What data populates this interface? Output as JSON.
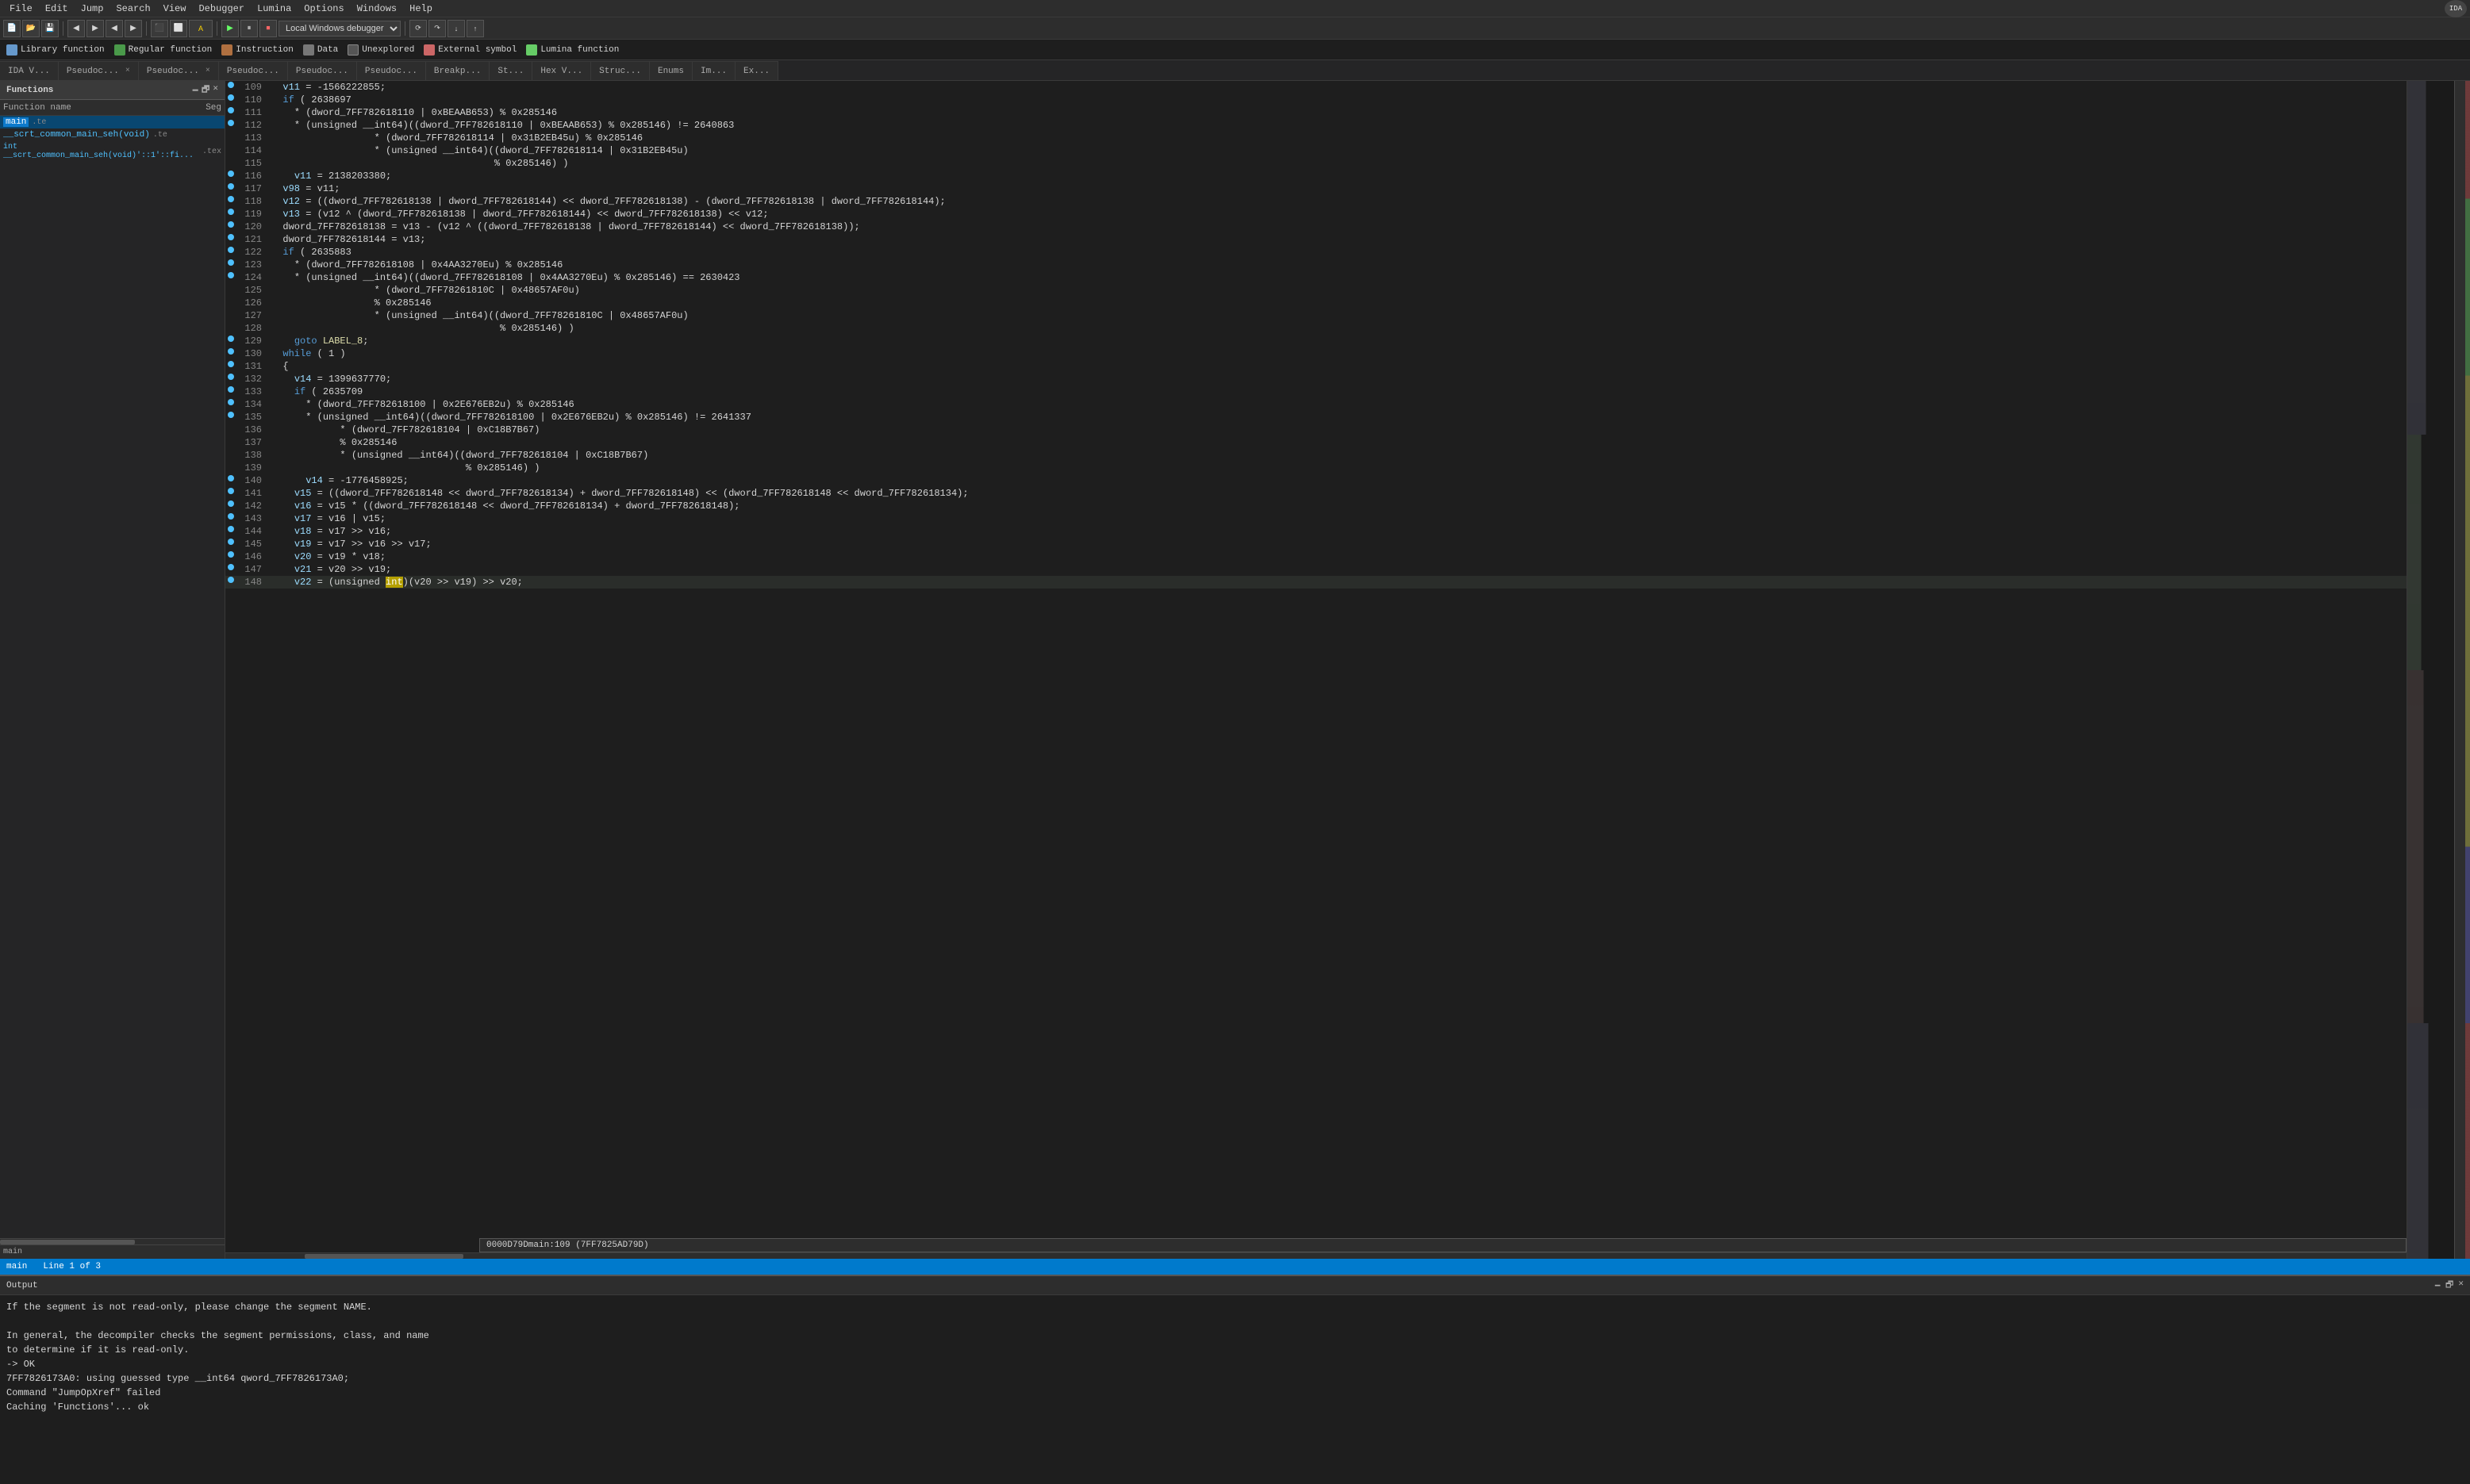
{
  "app": {
    "title": "IDA - main"
  },
  "menu": {
    "items": [
      "File",
      "Edit",
      "Jump",
      "Search",
      "View",
      "Debugger",
      "Lumina",
      "Options",
      "Windows",
      "Help"
    ]
  },
  "nav_indicators": [
    {
      "label": "Library function",
      "color": "#6699cc"
    },
    {
      "label": "Regular function",
      "color": "#4a9a4a"
    },
    {
      "label": "Instruction",
      "color": "#b07040"
    },
    {
      "label": "Data",
      "color": "#777"
    },
    {
      "label": "Unexplored",
      "color": "#444"
    },
    {
      "label": "External symbol",
      "color": "#cc6666"
    },
    {
      "label": "Lumina function",
      "color": "#66cc66"
    }
  ],
  "tabs": {
    "items": [
      {
        "label": "IDA V...",
        "active": false,
        "icon": "📄"
      },
      {
        "label": "Pseudoc...",
        "active": false,
        "icon": "📄",
        "close": true
      },
      {
        "label": "Pseudoc...",
        "active": false,
        "icon": "📄",
        "close": true
      },
      {
        "label": "Pseudoc...",
        "active": false,
        "icon": "📄"
      },
      {
        "label": "Pseudoc...",
        "active": false,
        "icon": "📄"
      },
      {
        "label": "Pseudoc...",
        "active": false,
        "icon": "📄"
      },
      {
        "label": "Breakp...",
        "active": false,
        "icon": "📄"
      },
      {
        "label": "St...",
        "active": false,
        "icon": "📄"
      },
      {
        "label": "Hex V...",
        "active": false,
        "icon": "📄"
      },
      {
        "label": "Struc...",
        "active": false,
        "icon": "📄"
      },
      {
        "label": "Enums",
        "active": false,
        "icon": "📄"
      },
      {
        "label": "Im...",
        "active": false,
        "icon": "📄"
      },
      {
        "label": "Ex...",
        "active": false,
        "icon": "📄"
      }
    ]
  },
  "left_panel": {
    "title": "Functions",
    "subheader": "Function name",
    "subheader2": "Seg",
    "functions": [
      {
        "name": "main",
        "seg": ".te",
        "selected": true
      },
      {
        "name": "__scrt_common_main_seh(void)",
        "seg": ".te"
      },
      {
        "name": "int __scrt_common_main_seh(void)'::1'::fi...",
        "seg": ".tex"
      }
    ]
  },
  "code": {
    "lines": [
      {
        "num": 109,
        "dot": true,
        "text": "  v11 = -1566222855;"
      },
      {
        "num": 110,
        "dot": true,
        "text": "  if ( 2638697"
      },
      {
        "num": 111,
        "dot": true,
        "text": "    * (dword_7FF782618110 | 0xBEAAB653) % 0x285146"
      },
      {
        "num": 112,
        "dot": true,
        "text": "    * (unsigned __int64)((dword_7FF782618110 | 0xBEAAB653) % 0x285146) != 2640863"
      },
      {
        "num": 113,
        "dot": false,
        "text": "                  * (dword_7FF782618114 | 0x31B2EB45u) % 0x285146"
      },
      {
        "num": 114,
        "dot": false,
        "text": "                  * (unsigned __int64)((dword_7FF782618114 | 0x31B2EB45u)"
      },
      {
        "num": 115,
        "dot": false,
        "text": "                                       % 0x285146) )"
      },
      {
        "num": 116,
        "dot": true,
        "text": "    v11 = 2138203380;"
      },
      {
        "num": 117,
        "dot": true,
        "text": "  v98 = v11;"
      },
      {
        "num": 118,
        "dot": true,
        "text": "  v12 = ((dword_7FF782618138 | dword_7FF782618144) << dword_7FF782618138) - (dword_7FF782618138 | dword_7FF782618144);"
      },
      {
        "num": 119,
        "dot": true,
        "text": "  v13 = (v12 ^ (dword_7FF782618138 | dword_7FF782618144) << dword_7FF782618138) << v12;"
      },
      {
        "num": 120,
        "dot": true,
        "text": "  dword_7FF782618138 = v13 - (v12 ^ ((dword_7FF782618138 | dword_7FF782618144) << dword_7FF782618138));"
      },
      {
        "num": 121,
        "dot": true,
        "text": "  dword_7FF782618144 = v13;"
      },
      {
        "num": 122,
        "dot": true,
        "text": "  if ( 2635883"
      },
      {
        "num": 123,
        "dot": true,
        "text": "    * (dword_7FF782618108 | 0x4AA3270Eu) % 0x285146"
      },
      {
        "num": 124,
        "dot": true,
        "text": "    * (unsigned __int64)((dword_7FF782618108 | 0x4AA3270Eu) % 0x285146) == 2630423"
      },
      {
        "num": 125,
        "dot": false,
        "text": "                  * (dword_7FF78261810C | 0x48657AF0u)"
      },
      {
        "num": 126,
        "dot": false,
        "text": "                  % 0x285146"
      },
      {
        "num": 127,
        "dot": false,
        "text": "                  * (unsigned __int64)((dword_7FF78261810C | 0x48657AF0u)"
      },
      {
        "num": 128,
        "dot": false,
        "text": "                                        % 0x285146) )"
      },
      {
        "num": 129,
        "dot": true,
        "text": "    goto LABEL_8;"
      },
      {
        "num": 130,
        "dot": true,
        "text": "  while ( 1 )"
      },
      {
        "num": 131,
        "dot": true,
        "text": "  {"
      },
      {
        "num": 132,
        "dot": true,
        "text": "    v14 = 1399637770;"
      },
      {
        "num": 133,
        "dot": true,
        "text": "    if ( 2635709"
      },
      {
        "num": 134,
        "dot": true,
        "text": "      * (dword_7FF782618100 | 0x2E676EB2u) % 0x285146"
      },
      {
        "num": 135,
        "dot": true,
        "text": "      * (unsigned __int64)((dword_7FF782618100 | 0x2E676EB2u) % 0x285146) != 2641337"
      },
      {
        "num": 136,
        "dot": false,
        "text": "            * (dword_7FF782618104 | 0xC18B7B67)"
      },
      {
        "num": 137,
        "dot": false,
        "text": "            % 0x285146"
      },
      {
        "num": 138,
        "dot": false,
        "text": "            * (unsigned __int64)((dword_7FF782618104 | 0xC18B7B67)"
      },
      {
        "num": 139,
        "dot": false,
        "text": "                                  % 0x285146) )"
      },
      {
        "num": 140,
        "dot": true,
        "text": "      v14 = -1776458925;"
      },
      {
        "num": 141,
        "dot": true,
        "text": "    v15 = ((dword_7FF782618148 << dword_7FF782618134) + dword_7FF782618148) << (dword_7FF782618148 << dword_7FF782618134);"
      },
      {
        "num": 142,
        "dot": true,
        "text": "    v16 = v15 * ((dword_7FF782618148 << dword_7FF782618134) + dword_7FF782618148);"
      },
      {
        "num": 143,
        "dot": true,
        "text": "    v17 = v16 | v15;"
      },
      {
        "num": 144,
        "dot": true,
        "text": "    v18 = v17 >> v16;"
      },
      {
        "num": 145,
        "dot": true,
        "text": "    v19 = v17 >> v16 >> v17;"
      },
      {
        "num": 146,
        "dot": true,
        "text": "    v20 = v19 * v18;"
      },
      {
        "num": 147,
        "dot": true,
        "text": "    v21 = v20 >> v19;"
      },
      {
        "num": 148,
        "dot": true,
        "text": "    v22 = (unsigned int)(v20 >> v19) >> v20;"
      }
    ]
  },
  "location_bar": {
    "text": "0000D79Dmain:109 (7FF7825AD79D)"
  },
  "status_bar": {
    "text": "main",
    "line_info": "Line 1 of 3"
  },
  "output": {
    "title": "Output",
    "lines": [
      "If the segment is not read-only, please change the segment NAME.",
      "",
      "In general, the decompiler checks the segment permissions, class, and name",
      "to determine if it is read-only.",
      "  -> OK",
      "7FF7826173A0: using guessed type __int64 qword_7FF7826173A0;",
      "Command \"JumpOpXref\" failed",
      "Caching 'Functions'... ok"
    ]
  }
}
